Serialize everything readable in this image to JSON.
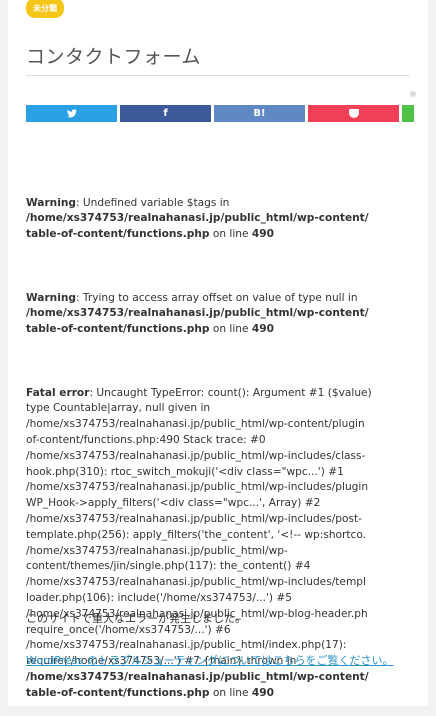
{
  "badge": "未分類",
  "page_title": "コンタクトフォーム",
  "share": {
    "twitter_icon": "twitter-bird-icon",
    "facebook_icon": "f",
    "hatena_icon": "B!",
    "pocket_icon": "pocket-icon",
    "line_icon": "line-icon"
  },
  "warning1": {
    "label": "Warning",
    "text1": ": Undefined variable $tags in",
    "path1": "/home/xs374753/realnahanasi.jp/public_html/wp-content/",
    "path2": "table-of-content/functions.php",
    "online": " on line ",
    "line": "490"
  },
  "warning2": {
    "label": "Warning",
    "text1": ": Trying to access array offset on value of type null in",
    "path1": "/home/xs374753/realnahanasi.jp/public_html/wp-content/",
    "path2": "table-of-content/functions.php",
    "online": " on line ",
    "line": "490"
  },
  "fatal": {
    "label": "Fatal error",
    "line1": ": Uncaught TypeError: count(): Argument #1 ($value)",
    "lines": [
      "type Countable|array, null given in",
      "/home/xs374753/realnahanasi.jp/public_html/wp-content/plugin",
      "of-content/functions.php:490 Stack trace: #0",
      "/home/xs374753/realnahanasi.jp/public_html/wp-includes/class-",
      "hook.php(310): rtoc_switch_mokuji('<div class=\"wpc...') #1",
      "/home/xs374753/realnahanasi.jp/public_html/wp-includes/plugin",
      "WP_Hook->apply_filters('<div class=\"wpc...', Array) #2",
      "/home/xs374753/realnahanasi.jp/public_html/wp-includes/post-",
      "template.php(256): apply_filters('the_content', '<!-- wp:shortco.",
      "/home/xs374753/realnahanasi.jp/public_html/wp-",
      "content/themes/jin/single.php(117): the_content() #4",
      "/home/xs374753/realnahanasi.jp/public_html/wp-includes/templ",
      "loader.php(106): include('/home/xs374753/...') #5",
      "/home/xs374753/realnahanasi.jp/public_html/wp-blog-header.ph",
      "require_once('/home/xs374753/...') #6",
      "/home/xs374753/realnahanasi.jp/public_html/index.php(17):",
      "require('/home/xs374753/...') #7 {main} thrown in"
    ],
    "path1": "/home/xs374753/realnahanasi.jp/public_html/wp-content/",
    "path2": "table-of-content/functions.php",
    "online": " on line ",
    "line": "490"
  },
  "critical_message": "このサイトで重大なエラーが発生しました。",
  "help_link": "WordPress のトラブルシューティングについてはこちらをご覧ください。"
}
